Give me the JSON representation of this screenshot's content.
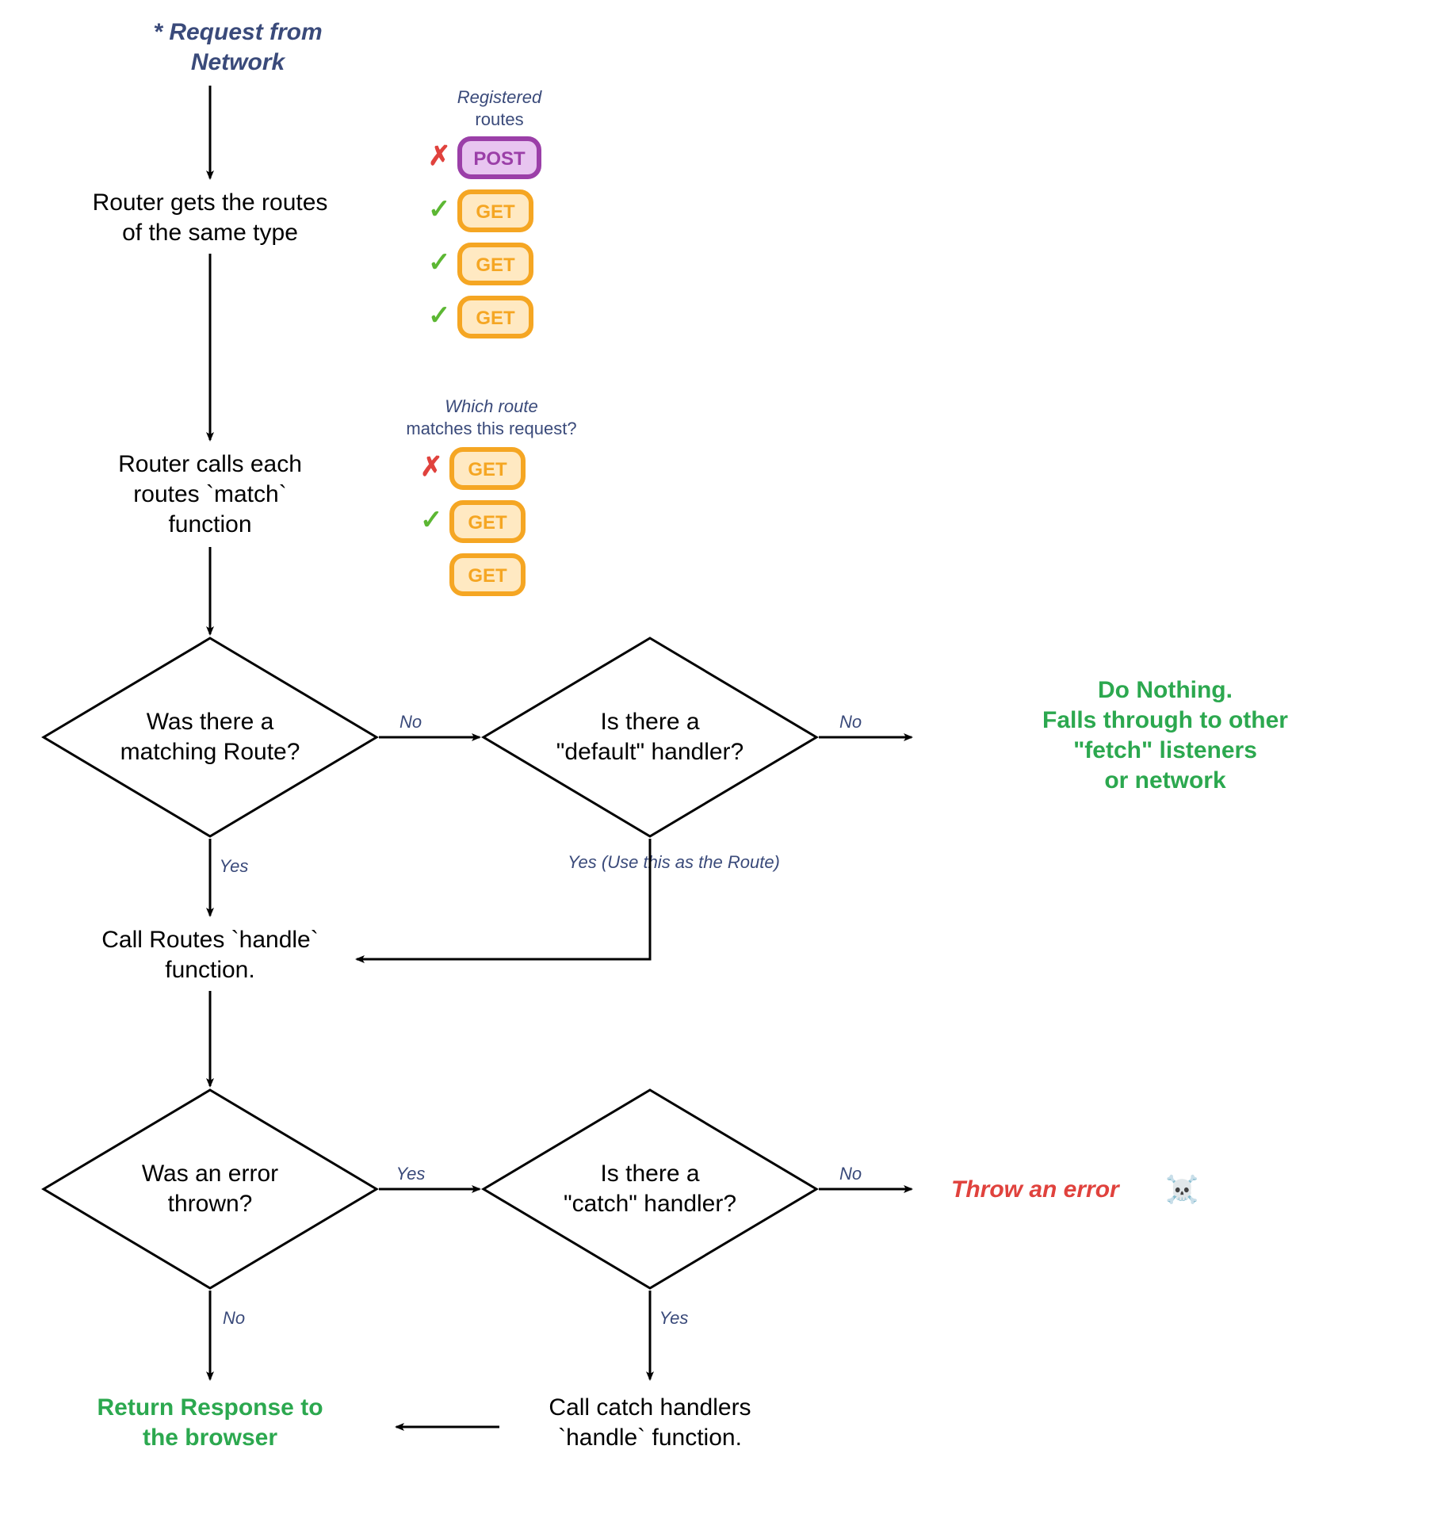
{
  "start": {
    "line1": "* Request from",
    "line2": "Network"
  },
  "step1": {
    "line1": "Router gets the routes",
    "line2": "of the same type"
  },
  "step2": {
    "line1": "Router calls each",
    "line2": "routes `match`",
    "line3": "function"
  },
  "decision1": {
    "line1": "Was there a",
    "line2": "matching Route?"
  },
  "decision2": {
    "line1": "Is there a",
    "line2": "\"default\" handler?"
  },
  "decision3": {
    "line1": "Was an error",
    "line2": "thrown?"
  },
  "decision4": {
    "line1": "Is there a",
    "line2": "\"catch\" handler?"
  },
  "callHandle": {
    "line1": "Call Routes `handle`",
    "line2": "function."
  },
  "callCatch": {
    "line1": "Call catch handlers",
    "line2": "`handle` function."
  },
  "returnResp": {
    "line1": "Return Response to",
    "line2": "the browser"
  },
  "doNothing": {
    "line1": "Do Nothing.",
    "line2": "Falls through to other",
    "line3": "\"fetch\" listeners",
    "line4": "or network"
  },
  "throwErr": "Throw an error",
  "labels": {
    "no": "No",
    "yes": "Yes",
    "yesRoute": "Yes (Use this as the Route)"
  },
  "legend1": {
    "line1": "Registered",
    "line2": "routes"
  },
  "legend2": {
    "line1": "Which route",
    "line2": "matches this request?"
  },
  "routes1": [
    {
      "method": "POST",
      "ok": false,
      "color": "purple"
    },
    {
      "method": "GET",
      "ok": true,
      "color": "orange"
    },
    {
      "method": "GET",
      "ok": true,
      "color": "orange"
    },
    {
      "method": "GET",
      "ok": true,
      "color": "orange"
    }
  ],
  "routes2": [
    {
      "method": "GET",
      "mark": "x",
      "color": "orange"
    },
    {
      "method": "GET",
      "mark": "check",
      "color": "orange"
    },
    {
      "method": "GET",
      "mark": "",
      "color": "orange"
    }
  ]
}
